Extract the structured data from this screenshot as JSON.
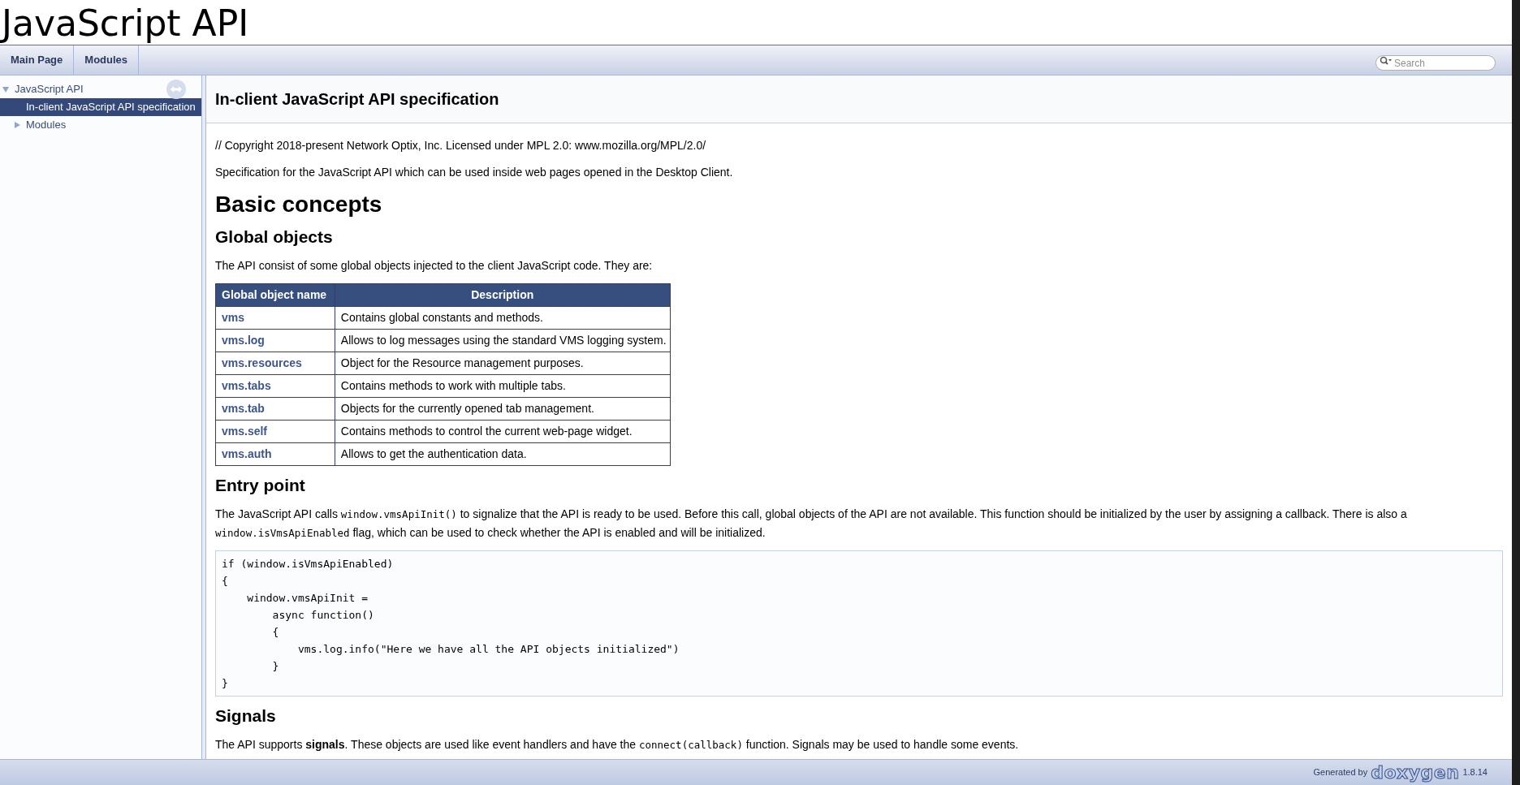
{
  "project_title": "JavaScript API",
  "nav": {
    "tabs": [
      {
        "label": "Main Page"
      },
      {
        "label": "Modules"
      }
    ],
    "search": {
      "placeholder": "Search"
    }
  },
  "sidebar": {
    "tree": [
      {
        "label": "JavaScript API",
        "expanded": true,
        "selected": false,
        "children": [
          {
            "label": "In-client JavaScript API specification",
            "selected": true
          },
          {
            "label": "Modules",
            "expanded": false,
            "selected": false
          }
        ]
      }
    ]
  },
  "page_title": "In-client JavaScript API specification",
  "content": [
    {
      "kind": "p",
      "segments": [
        {
          "kind": "text",
          "text": "// Copyright 2018-present Network Optix, Inc. Licensed under MPL 2.0: www.mozilla.org/MPL/2.0/"
        }
      ]
    },
    {
      "kind": "p",
      "segments": [
        {
          "kind": "text",
          "text": "Specification for the JavaScript API which can be used inside web pages opened in the Desktop Client."
        }
      ]
    },
    {
      "kind": "h1",
      "text": "Basic concepts"
    },
    {
      "kind": "h2",
      "text": "Global objects"
    },
    {
      "kind": "p",
      "segments": [
        {
          "kind": "text",
          "text": "The API consist of some global objects injected to the client JavaScript code. They are:"
        }
      ]
    },
    {
      "kind": "table",
      "columns": [
        "Global object name",
        "Description"
      ],
      "rows": [
        [
          "vms",
          "Contains global constants and methods."
        ],
        [
          "vms.log",
          "Allows to log messages using the standard VMS logging system."
        ],
        [
          "vms.resources",
          "Object for the Resource management purposes."
        ],
        [
          "vms.tabs",
          "Contains methods to work with multiple tabs."
        ],
        [
          "vms.tab",
          "Objects for the currently opened tab management."
        ],
        [
          "vms.self",
          "Contains methods to control the current web-page widget."
        ],
        [
          "vms.auth",
          "Allows to get the authentication data."
        ]
      ]
    },
    {
      "kind": "h2",
      "text": "Entry point"
    },
    {
      "kind": "p",
      "segments": [
        {
          "kind": "text",
          "text": "The JavaScript API calls "
        },
        {
          "kind": "code",
          "text": "window.vmsApiInit()"
        },
        {
          "kind": "text",
          "text": " to signalize that the API is ready to be used. Before this call, global objects of the API are not available. This function should be initialized by the user by assigning a callback. There is also a "
        },
        {
          "kind": "code",
          "text": "window.isVmsApiEnabled"
        },
        {
          "kind": "text",
          "text": " flag, which can be used to check whether the API is enabled and will be initialized."
        }
      ]
    },
    {
      "kind": "code",
      "lines": [
        "if (window.isVmsApiEnabled)",
        "{",
        "    window.vmsApiInit =",
        "        async function()",
        "        {",
        "            vms.log.info(\"Here we have all the API objects initialized\")",
        "        }",
        "}"
      ]
    },
    {
      "kind": "h2",
      "text": "Signals"
    },
    {
      "kind": "p",
      "segments": [
        {
          "kind": "text",
          "text": "The API supports **signals**. These objects are used like event handlers and have the "
        },
        {
          "kind": "code",
          "text": "connect(callback)"
        },
        {
          "kind": "text",
          "text": " function. Signals may be used to handle some events."
        }
      ]
    }
  ],
  "footer": {
    "generated_by": "Generated by",
    "logo": "doxygen",
    "version": "1.8.14"
  }
}
